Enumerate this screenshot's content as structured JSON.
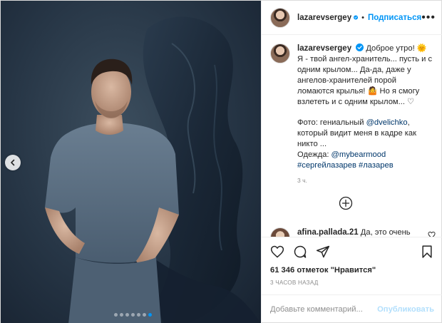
{
  "post": {
    "username": "lazarevsergey",
    "header_separator": "•",
    "follow_label": "Подписаться",
    "more_label": "•••",
    "caption": {
      "username": "lazarevsergey",
      "line1": "Доброе утро! 🌞 Я - твой ангел-хранитель... пусть и с одним крылом... Да-да, даже у ангелов-хранителей порой ломаются крылья! 🤷 Но я смогу взлететь и с одним крылом... ♡",
      "photo_prefix": "Фото: гениальный ",
      "photo_link": "@dvelichko",
      "photo_suffix": ", который видит меня в кадре как никто ...",
      "clothes_prefix": "Одежда: ",
      "clothes_link": "@mybearmood",
      "tag1": "#сергейлазарев",
      "tag2": "#лазарев",
      "time": "3 ч."
    },
    "comment": {
      "username": "afina.pallada.21",
      "text": "Да, это очень"
    },
    "likes": "61 346 отметок \"Нравится\"",
    "posted_ago": "3 ЧАСОВ НАЗАД",
    "add_comment_placeholder": "Добавьте комментарий...",
    "publish_label": "Опубликовать",
    "carousel": {
      "total": 7,
      "active_index": 6
    },
    "icons": [
      "chevron-left-icon",
      "verified-icon",
      "heart-icon",
      "comment-icon",
      "share-icon",
      "bookmark-icon",
      "plus-circle-icon"
    ],
    "colors": {
      "accent": "#0095f6",
      "link": "#00376b",
      "muted": "#8e8e8e",
      "publish_disabled": "#b2dffc"
    }
  }
}
